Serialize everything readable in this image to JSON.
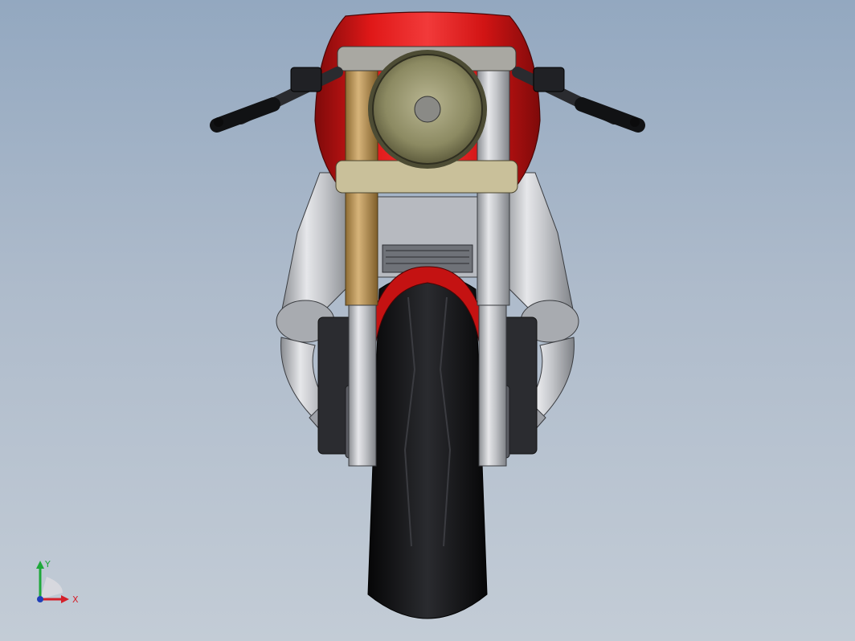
{
  "viewport": {
    "background_top": "#93a8c0",
    "background_bottom": "#c3ccd6"
  },
  "model": {
    "fairing_color": "#c81010",
    "fork_gold": "#b28a4a",
    "fork_silver": "#b9bcc2",
    "exhaust_silver": "#c9cbd0",
    "tire_black": "#16171a",
    "headlight_olive": "#8f8d66"
  },
  "triad": {
    "x_label": "X",
    "y_label": "Y",
    "x_color": "#d4202a",
    "y_color": "#1ea83a",
    "z_color": "#1f3fb8"
  }
}
